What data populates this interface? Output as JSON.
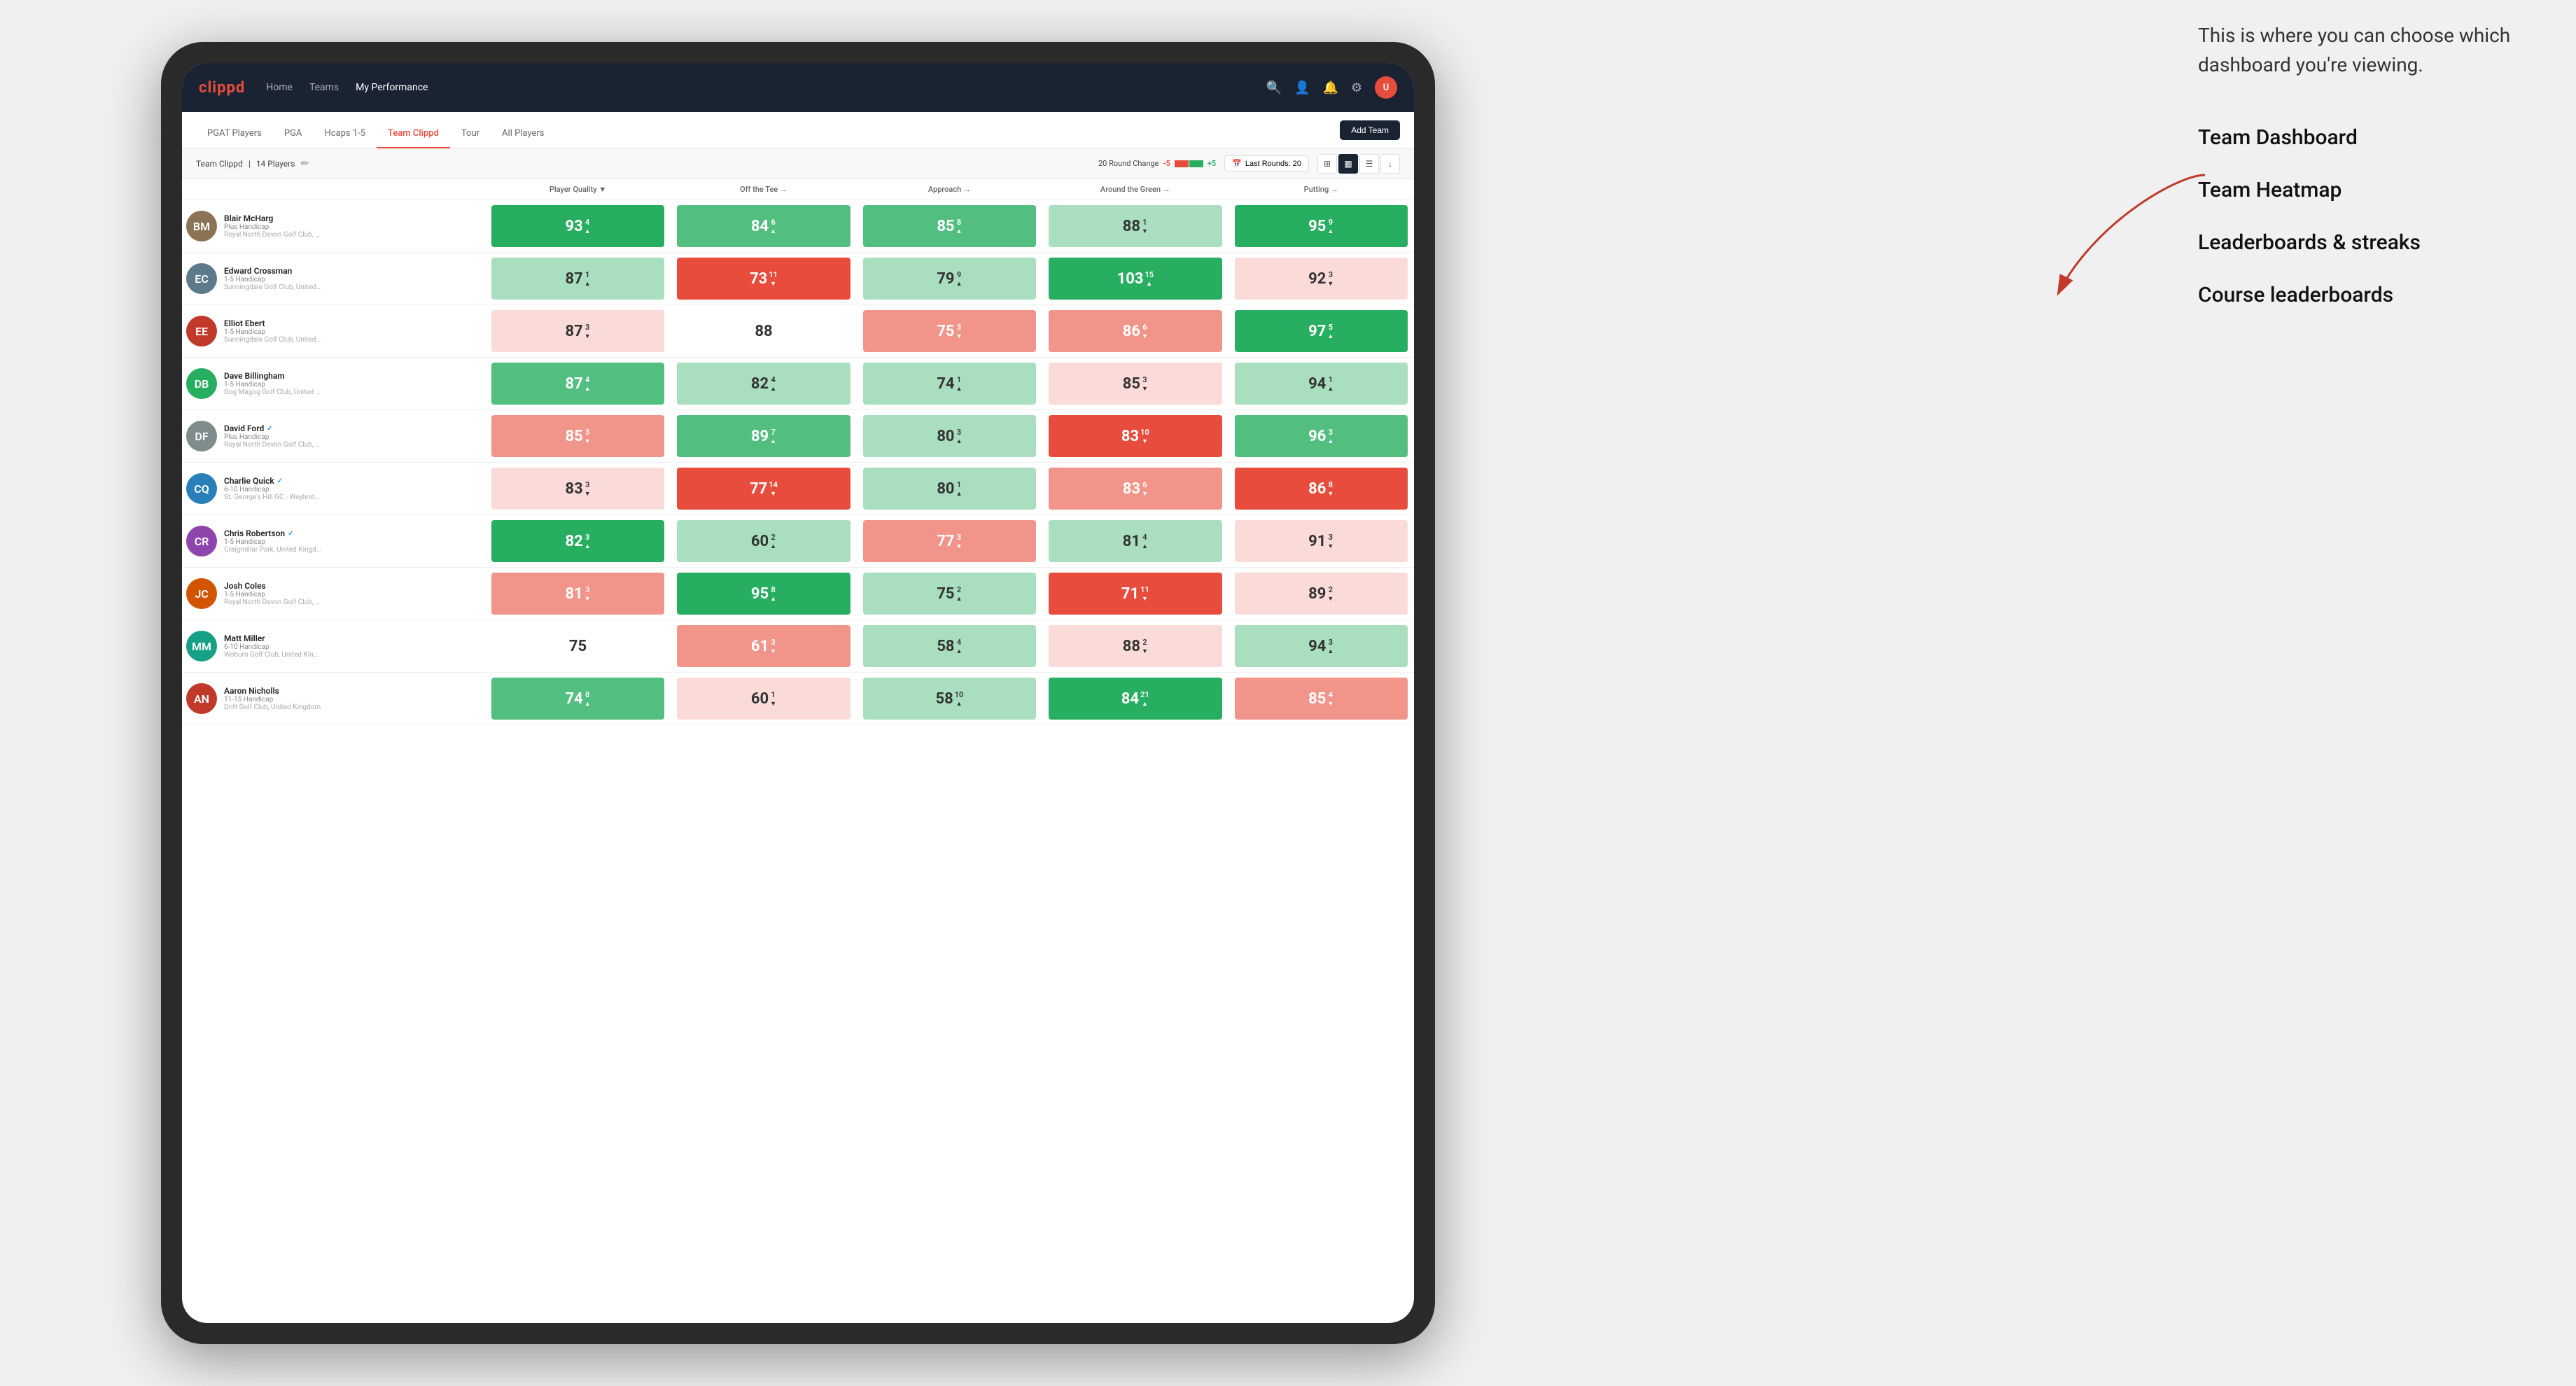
{
  "annotation": {
    "tooltip_text": "This is where you can choose which dashboard you're viewing.",
    "items": [
      "Team Dashboard",
      "Team Heatmap",
      "Leaderboards & streaks",
      "Course leaderboards"
    ]
  },
  "navbar": {
    "logo": "clippd",
    "nav_items": [
      "Home",
      "Teams",
      "My Performance"
    ],
    "active_nav": "My Performance"
  },
  "subnav": {
    "tabs": [
      "PGAT Players",
      "PGA",
      "Hcaps 1-5",
      "Team Clippd",
      "Tour",
      "All Players"
    ],
    "active_tab": "Team Clippd",
    "add_team_label": "Add Team"
  },
  "team_bar": {
    "team_name": "Team Clippd",
    "player_count": "14 Players",
    "round_change_label": "20 Round Change",
    "change_minus": "-5",
    "change_plus": "+5",
    "last_rounds_label": "Last Rounds: 20"
  },
  "table": {
    "headers": {
      "player": "Player Quality ▼",
      "off_tee": "Off the Tee →",
      "approach": "Approach →",
      "around_green": "Around the Green →",
      "putting": "Putting →"
    },
    "players": [
      {
        "name": "Blair McHarg",
        "handicap": "Plus Handicap",
        "club": "Royal North Devon Golf Club, United Kingdom",
        "avatar_color": "#8B7355",
        "initials": "BM",
        "player_quality": {
          "value": 93,
          "change": 4,
          "dir": "up",
          "bg": "bg-green-dark"
        },
        "off_tee": {
          "value": 84,
          "change": 6,
          "dir": "up",
          "bg": "bg-green-mid"
        },
        "approach": {
          "value": 85,
          "change": 8,
          "dir": "up",
          "bg": "bg-green-mid"
        },
        "around_green": {
          "value": 88,
          "change": 1,
          "dir": "down",
          "bg": "bg-green-light"
        },
        "putting": {
          "value": 95,
          "change": 9,
          "dir": "up",
          "bg": "bg-green-dark"
        }
      },
      {
        "name": "Edward Crossman",
        "handicap": "1-5 Handicap",
        "club": "Sunningdale Golf Club, United Kingdom",
        "avatar_color": "#5d7a8a",
        "initials": "EC",
        "player_quality": {
          "value": 87,
          "change": 1,
          "dir": "up",
          "bg": "bg-green-light"
        },
        "off_tee": {
          "value": 73,
          "change": 11,
          "dir": "down",
          "bg": "bg-red-dark"
        },
        "approach": {
          "value": 79,
          "change": 9,
          "dir": "up",
          "bg": "bg-green-light"
        },
        "around_green": {
          "value": 103,
          "change": 15,
          "dir": "up",
          "bg": "bg-green-dark"
        },
        "putting": {
          "value": 92,
          "change": 3,
          "dir": "down",
          "bg": "bg-red-light"
        }
      },
      {
        "name": "Elliot Ebert",
        "handicap": "1-5 Handicap",
        "club": "Sunningdale Golf Club, United Kingdom",
        "avatar_color": "#c0392b",
        "initials": "EE",
        "player_quality": {
          "value": 87,
          "change": 3,
          "dir": "down",
          "bg": "bg-red-light"
        },
        "off_tee": {
          "value": 88,
          "change": 0,
          "dir": null,
          "bg": "bg-white"
        },
        "approach": {
          "value": 75,
          "change": 3,
          "dir": "down",
          "bg": "bg-red-mid"
        },
        "around_green": {
          "value": 86,
          "change": 6,
          "dir": "down",
          "bg": "bg-red-mid"
        },
        "putting": {
          "value": 97,
          "change": 5,
          "dir": "up",
          "bg": "bg-green-dark"
        }
      },
      {
        "name": "Dave Billingham",
        "handicap": "1-5 Handicap",
        "club": "Gog Magog Golf Club, United Kingdom",
        "avatar_color": "#27ae60",
        "initials": "DB",
        "player_quality": {
          "value": 87,
          "change": 4,
          "dir": "up",
          "bg": "bg-green-mid"
        },
        "off_tee": {
          "value": 82,
          "change": 4,
          "dir": "up",
          "bg": "bg-green-light"
        },
        "approach": {
          "value": 74,
          "change": 1,
          "dir": "up",
          "bg": "bg-green-light"
        },
        "around_green": {
          "value": 85,
          "change": 3,
          "dir": "down",
          "bg": "bg-red-light"
        },
        "putting": {
          "value": 94,
          "change": 1,
          "dir": "up",
          "bg": "bg-green-light"
        }
      },
      {
        "name": "David Ford",
        "handicap": "Plus Handicap",
        "club": "Royal North Devon Golf Club, United Kingdom",
        "avatar_color": "#7f8c8d",
        "initials": "DF",
        "verified": true,
        "player_quality": {
          "value": 85,
          "change": 3,
          "dir": "down",
          "bg": "bg-red-mid"
        },
        "off_tee": {
          "value": 89,
          "change": 7,
          "dir": "up",
          "bg": "bg-green-mid"
        },
        "approach": {
          "value": 80,
          "change": 3,
          "dir": "up",
          "bg": "bg-green-light"
        },
        "around_green": {
          "value": 83,
          "change": 10,
          "dir": "down",
          "bg": "bg-red-dark"
        },
        "putting": {
          "value": 96,
          "change": 3,
          "dir": "up",
          "bg": "bg-green-mid"
        }
      },
      {
        "name": "Charlie Quick",
        "handicap": "6-10 Handicap",
        "club": "St. George's Hill GC - Weybridge - Surrey, Uni...",
        "avatar_color": "#2980b9",
        "initials": "CQ",
        "verified": true,
        "player_quality": {
          "value": 83,
          "change": 3,
          "dir": "down",
          "bg": "bg-red-light"
        },
        "off_tee": {
          "value": 77,
          "change": 14,
          "dir": "down",
          "bg": "bg-red-dark"
        },
        "approach": {
          "value": 80,
          "change": 1,
          "dir": "up",
          "bg": "bg-green-light"
        },
        "around_green": {
          "value": 83,
          "change": 6,
          "dir": "down",
          "bg": "bg-red-mid"
        },
        "putting": {
          "value": 86,
          "change": 8,
          "dir": "down",
          "bg": "bg-red-dark"
        }
      },
      {
        "name": "Chris Robertson",
        "handicap": "1-5 Handicap",
        "club": "Craigmillar Park, United Kingdom",
        "avatar_color": "#8e44ad",
        "initials": "CR",
        "verified": true,
        "player_quality": {
          "value": 82,
          "change": 3,
          "dir": "up",
          "bg": "bg-green-dark"
        },
        "off_tee": {
          "value": 60,
          "change": 2,
          "dir": "up",
          "bg": "bg-green-light"
        },
        "approach": {
          "value": 77,
          "change": 3,
          "dir": "down",
          "bg": "bg-red-mid"
        },
        "around_green": {
          "value": 81,
          "change": 4,
          "dir": "up",
          "bg": "bg-green-light"
        },
        "putting": {
          "value": 91,
          "change": 3,
          "dir": "down",
          "bg": "bg-red-light"
        }
      },
      {
        "name": "Josh Coles",
        "handicap": "1-5 Handicap",
        "club": "Royal North Devon Golf Club, United Kingdom",
        "avatar_color": "#d35400",
        "initials": "JC",
        "player_quality": {
          "value": 81,
          "change": 3,
          "dir": "down",
          "bg": "bg-red-mid"
        },
        "off_tee": {
          "value": 95,
          "change": 8,
          "dir": "up",
          "bg": "bg-green-dark"
        },
        "approach": {
          "value": 75,
          "change": 2,
          "dir": "up",
          "bg": "bg-green-light"
        },
        "around_green": {
          "value": 71,
          "change": 11,
          "dir": "down",
          "bg": "bg-red-dark"
        },
        "putting": {
          "value": 89,
          "change": 2,
          "dir": "down",
          "bg": "bg-red-light"
        }
      },
      {
        "name": "Matt Miller",
        "handicap": "6-10 Handicap",
        "club": "Woburn Golf Club, United Kingdom",
        "avatar_color": "#16a085",
        "initials": "MM",
        "player_quality": {
          "value": 75,
          "change": 0,
          "dir": null,
          "bg": "bg-white"
        },
        "off_tee": {
          "value": 61,
          "change": 3,
          "dir": "down",
          "bg": "bg-red-mid"
        },
        "approach": {
          "value": 58,
          "change": 4,
          "dir": "up",
          "bg": "bg-green-light"
        },
        "around_green": {
          "value": 88,
          "change": 2,
          "dir": "down",
          "bg": "bg-red-light"
        },
        "putting": {
          "value": 94,
          "change": 3,
          "dir": "up",
          "bg": "bg-green-light"
        }
      },
      {
        "name": "Aaron Nicholls",
        "handicap": "11-15 Handicap",
        "club": "Drift Golf Club, United Kingdom",
        "avatar_color": "#c0392b",
        "initials": "AN",
        "player_quality": {
          "value": 74,
          "change": 8,
          "dir": "up",
          "bg": "bg-green-mid"
        },
        "off_tee": {
          "value": 60,
          "change": 1,
          "dir": "down",
          "bg": "bg-red-light"
        },
        "approach": {
          "value": 58,
          "change": 10,
          "dir": "up",
          "bg": "bg-green-light"
        },
        "around_green": {
          "value": 84,
          "change": 21,
          "dir": "up",
          "bg": "bg-green-dark"
        },
        "putting": {
          "value": 85,
          "change": 4,
          "dir": "down",
          "bg": "bg-red-mid"
        }
      }
    ]
  }
}
